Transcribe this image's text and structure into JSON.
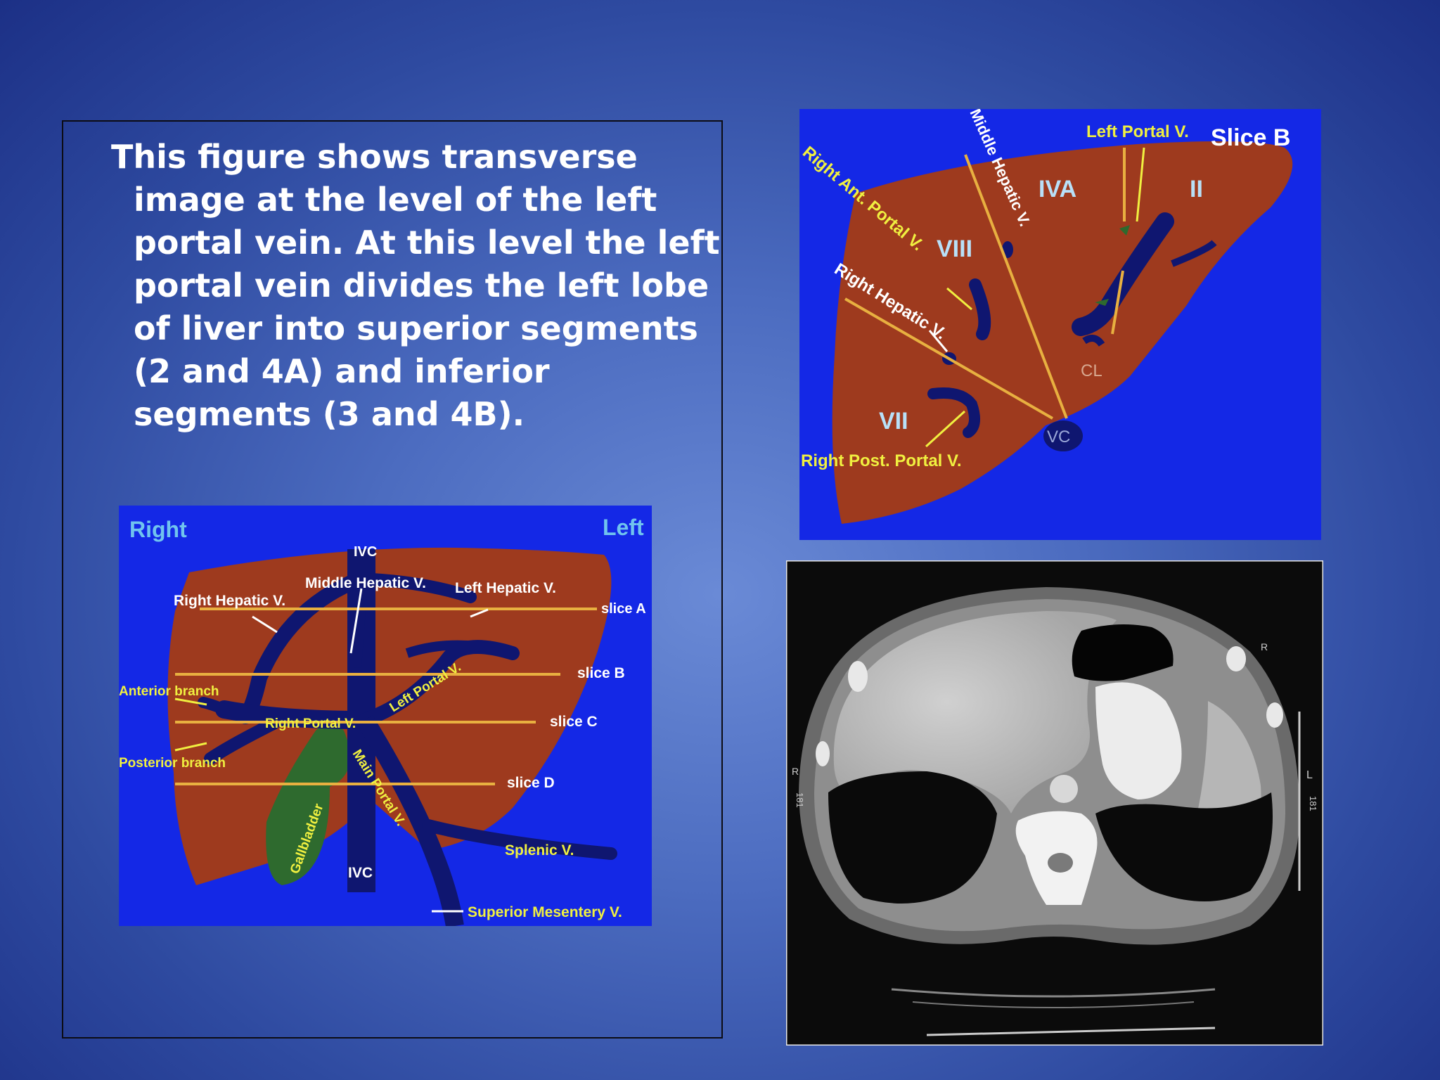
{
  "caption": "This figure shows transverse image at the level of the left portal vein. At this level the left portal vein divides the left lobe of liver into superior segments (2 and 4A) and inferior segments (3 and 4B).",
  "overview_diagram": {
    "side_right": "Right",
    "side_left": "Left",
    "ivc_top": "IVC",
    "ivc_bottom": "IVC",
    "right_hepatic_v": "Right Hepatic V.",
    "middle_hepatic_v": "Middle Hepatic V.",
    "left_hepatic_v": "Left Hepatic V.",
    "slice_a": "slice A",
    "slice_b": "slice B",
    "slice_c": "slice C",
    "slice_d": "slice D",
    "anterior_branch": "Anterior branch",
    "posterior_branch": "Posterior branch",
    "right_portal_v": "Right Portal V.",
    "left_portal_v": "Left Portal V.",
    "main_portal_v": "Main Portal V.",
    "gallbladder": "Gallbladder",
    "splenic_v": "Splenic V.",
    "superior_mesentery_v": "Superior Mesentery V."
  },
  "slice_b_diagram": {
    "title": "Slice B",
    "left_portal_v": "Left Portal V.",
    "middle_hepatic_v": "Middle Hepatic V.",
    "right_ant_portal_v": "Right Ant. Portal V.",
    "right_hepatic_v": "Right Hepatic V.",
    "right_post_portal_v": "Right Post. Portal V.",
    "seg_iva": "IVA",
    "seg_ii": "II",
    "seg_viii": "VIII",
    "seg_vii": "VII",
    "cl": "CL",
    "vc": "VC"
  },
  "ct_scan": {
    "marker_r_top": "R",
    "marker_l": "L",
    "marker_r_left": "R",
    "side_numbers_left": "181",
    "side_numbers_right": "181"
  },
  "colors": {
    "liver": "#9e3a1e",
    "vessel": "#0f1670",
    "diagram_bg": "#1428e6",
    "label_yellow": "#f0f040",
    "slice_line": "#e8b040",
    "gallbladder": "#2e6a2e"
  }
}
